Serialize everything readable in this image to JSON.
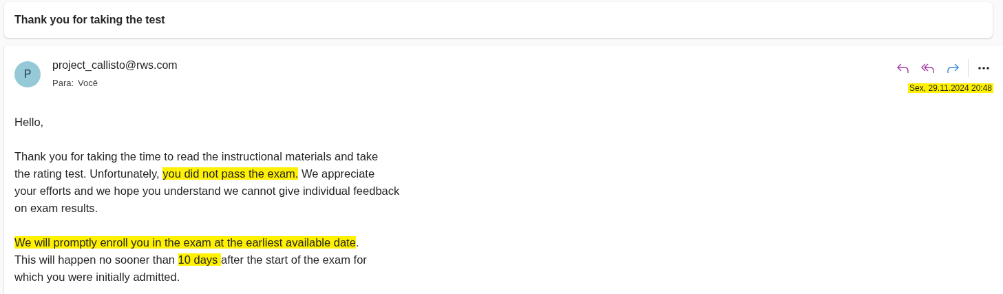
{
  "subject": "Thank you for taking the test",
  "message": {
    "avatar_letter": "P",
    "sender": "project_callisto@rws.com",
    "to_label": "Para:",
    "to_value": "Você",
    "date": "Sex, 29.11.2024 20:48",
    "date_highlighted": true,
    "actions": [
      {
        "kind": "reply"
      },
      {
        "kind": "reply_all"
      },
      {
        "kind": "forward"
      },
      {
        "kind": "more"
      }
    ],
    "body": [
      {
        "lines": [
          [
            {
              "text": "Hello,",
              "highlighted": false
            }
          ]
        ]
      },
      {
        "lines": [
          [
            {
              "text": "Thank you for taking the time to read the instructional materials and take",
              "highlighted": false
            }
          ],
          [
            {
              "text": "the rating test. Unfortunately, ",
              "highlighted": false
            },
            {
              "text": "you did not pass the exam.",
              "highlighted": true
            },
            {
              "text": " We appreciate",
              "highlighted": false
            }
          ],
          [
            {
              "text": "your efforts and we hope you understand we cannot give individual feedback",
              "highlighted": false
            }
          ],
          [
            {
              "text": "on exam results.",
              "highlighted": false
            }
          ]
        ]
      },
      {
        "lines": [
          [
            {
              "text": "We will promptly enroll you in the exam at the earliest available date",
              "highlighted": true
            },
            {
              "text": ".",
              "highlighted": false
            }
          ],
          [
            {
              "text": "This will happen no sooner than ",
              "highlighted": false
            },
            {
              "text": "10 days ",
              "highlighted": true
            },
            {
              "text": "after the start of the exam for",
              "highlighted": false
            }
          ],
          [
            {
              "text": "which you were initially admitted.",
              "highlighted": false
            }
          ]
        ]
      }
    ]
  }
}
